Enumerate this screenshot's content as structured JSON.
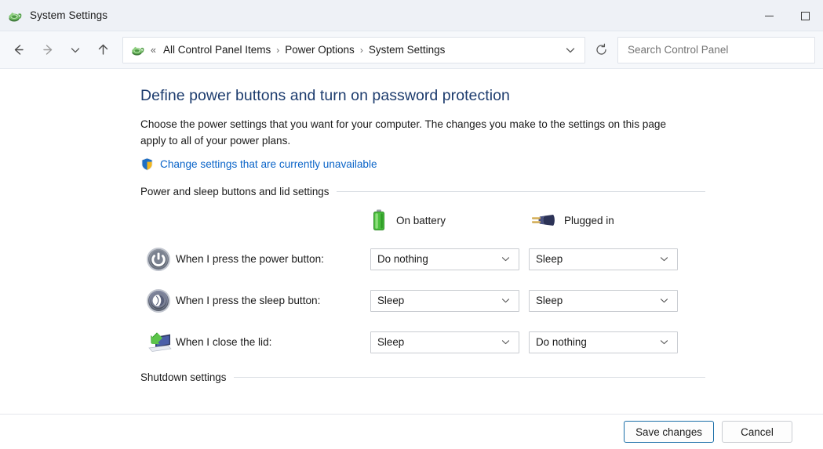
{
  "window": {
    "title": "System Settings",
    "icon": "control-panel-icon",
    "controls": {
      "minimize": "minimize",
      "maximize": "maximize"
    }
  },
  "navbar": {
    "back": "back-arrow",
    "forward": "forward-arrow",
    "recent": "recent-locations-chevron",
    "up": "up-arrow",
    "refresh": "refresh",
    "breadcrumb_prefix": "«",
    "breadcrumbs": [
      {
        "label": "All Control Panel Items"
      },
      {
        "label": "Power Options"
      },
      {
        "label": "System Settings"
      }
    ],
    "separator": "›",
    "dropdown": "address-dropdown-chevron",
    "search": {
      "placeholder": "Search Control Panel",
      "value": ""
    }
  },
  "page": {
    "heading": "Define power buttons and turn on password protection",
    "description": "Choose the power settings that you want for your computer. The changes you make to the settings on this page apply to all of your power plans.",
    "uac_link": "Change settings that are currently unavailable",
    "uac_icon": "shield-icon",
    "section_title": "Power and sleep buttons and lid settings",
    "columns": [
      {
        "icon": "battery-icon",
        "label": "On battery"
      },
      {
        "icon": "power-plug-icon",
        "label": "Plugged in"
      }
    ],
    "rows": [
      {
        "icon": "power-button-icon",
        "label": "When I press the power button:",
        "on_battery": "Do nothing",
        "plugged_in": "Sleep"
      },
      {
        "icon": "sleep-button-icon",
        "label": "When I press the sleep button:",
        "on_battery": "Sleep",
        "plugged_in": "Sleep"
      },
      {
        "icon": "laptop-lid-icon",
        "label": "When I close the lid:",
        "on_battery": "Sleep",
        "plugged_in": "Do nothing"
      }
    ],
    "shutdown_section_title": "Shutdown settings"
  },
  "footer": {
    "save_label": "Save changes",
    "cancel_label": "Cancel"
  },
  "colors": {
    "heading": "#1d3c6e",
    "link": "#0a64c8",
    "accent_button_border": "#1a6ea8",
    "battery_green": "#46b43c",
    "titlebar_bg": "#eef1f6"
  }
}
